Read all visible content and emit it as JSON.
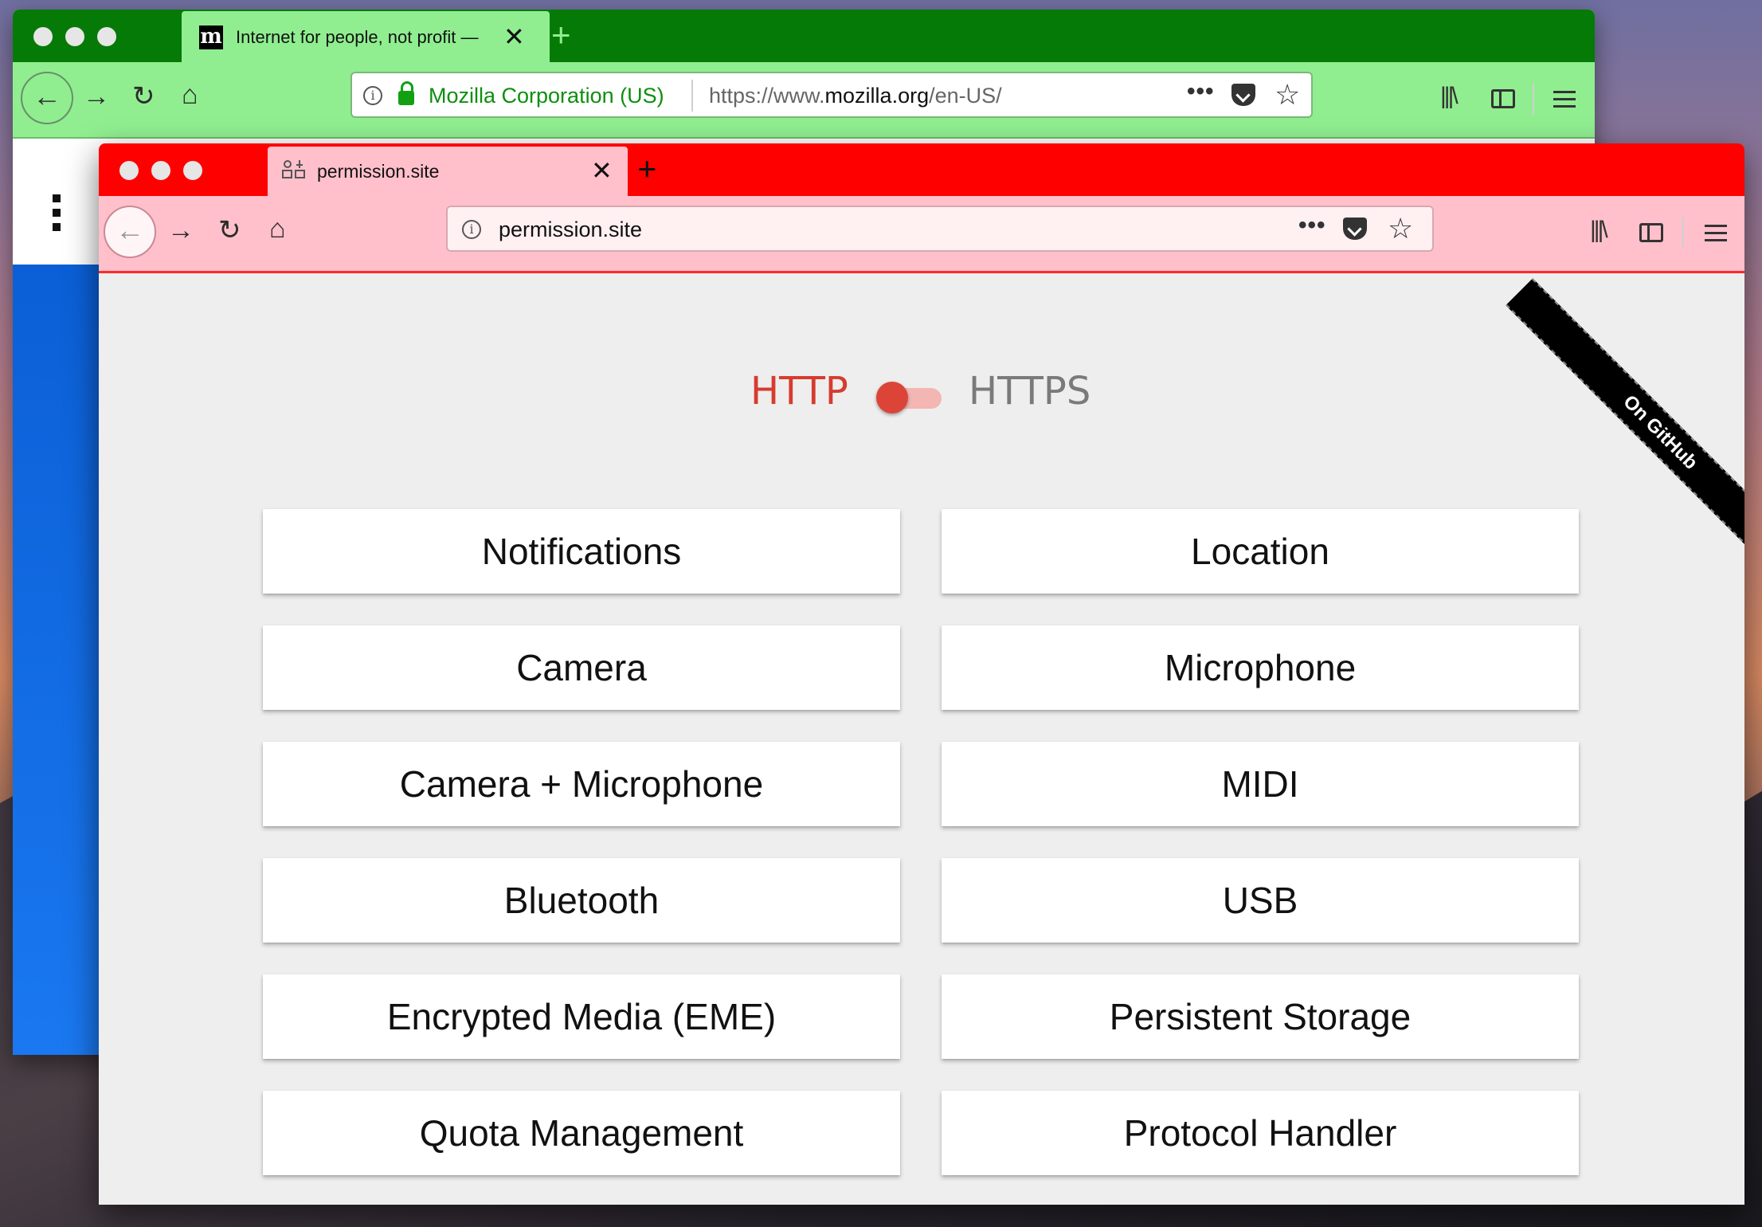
{
  "back_window": {
    "tab_title": "Internet for people, not profit —",
    "favicon_letter": "m",
    "identity_label": "Mozilla Corporation (US)",
    "url_prefix": "https://www.",
    "url_domain": "mozilla.org",
    "url_suffix": "/en-US/",
    "theme_color": "#067a06",
    "toolbar_color": "#90ee90"
  },
  "front_window": {
    "tab_title": "permission.site",
    "url": "permission.site",
    "theme_color": "#ff0000",
    "toolbar_color": "#ffc0cb"
  },
  "page": {
    "ribbon_text": "On GitHub",
    "protocol_left": "HTTP",
    "protocol_right": "HTTPS",
    "buttons": [
      "Notifications",
      "Location",
      "Camera",
      "Microphone",
      "Camera + Microphone",
      "MIDI",
      "Bluetooth",
      "USB",
      "Encrypted Media (EME)",
      "Persistent Storage",
      "Quota Management",
      "Protocol Handler"
    ]
  },
  "icons": {
    "nav": [
      "back-icon",
      "forward-icon",
      "reload-icon",
      "home-icon"
    ],
    "toolbar": [
      "library-icon",
      "sidebar-icon",
      "menu-icon"
    ]
  }
}
